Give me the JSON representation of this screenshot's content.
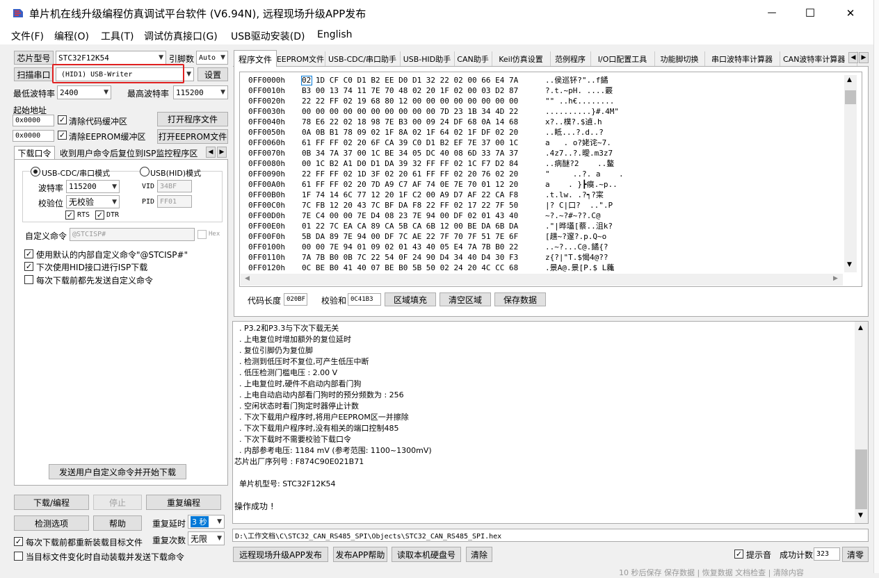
{
  "window": {
    "title": "单片机在线升级编程仿真调试平台软件 (V6.94N), 远程现场升级APP发布",
    "minimize": "—",
    "maximize": "☐",
    "close": "✕"
  },
  "menu": [
    "文件(F)",
    "编程(O)",
    "工具(T)",
    "调试仿真接口(G)",
    "USB驱动安装(D)",
    "English"
  ],
  "left": {
    "chip_model_btn": "芯片型号",
    "chip_model": "STC32F12K54",
    "pin_count_label": "引脚数",
    "pin_count": "Auto",
    "scan_port_btn": "扫描串口",
    "port": "(HID1) USB-Writer",
    "settings_btn": "设置",
    "min_baud_label": "最低波特率",
    "min_baud": "2400",
    "max_baud_label": "最高波特率",
    "max_baud": "115200",
    "start_addr_label": "起始地址",
    "addr1": "0x0000",
    "clear_code_label": "清除代码缓冲区",
    "open_prog_btn": "打开程序文件",
    "addr2": "0x0000",
    "clear_eeprom_label": "清除EEPROM缓冲区",
    "open_eeprom_btn": "打开EEPROM文件",
    "tab_download": "下载口令",
    "tab_reset": "收到用户命令后复位到ISP监控程序区",
    "usb_cdc_mode": "USB-CDC/串口模式",
    "usb_hid_mode": "USB(HID)模式",
    "baud_label": "波特率",
    "baud": "115200",
    "parity_label": "校验位",
    "parity": "无校验",
    "rts": "RTS",
    "dtr": "DTR",
    "vid_label": "VID",
    "vid": "34BF",
    "pid_label": "PID",
    "pid": "FF01",
    "custom_cmd_label": "自定义命令",
    "custom_cmd": "@STCISP#",
    "hex_label": "Hex",
    "opt1": "使用默认的内部自定义命令\"@STCISP#\"",
    "opt2": "下次使用HID接口进行ISP下载",
    "opt3": "每次下载前都先发送自定义命令",
    "send_cmd_btn": "发送用户自定义命令并开始下载",
    "download_btn": "下载/编程",
    "stop_btn": "停止",
    "reprogram_btn": "重复编程",
    "check_btn": "检测选项",
    "help_btn": "帮助",
    "repeat_delay_label": "重复延时",
    "repeat_delay": "3 秒",
    "repeat_count_label": "重复次数",
    "repeat_count": "无限",
    "reload_label": "每次下载前都重新装载目标文件",
    "autoload_label": "当目标文件变化时自动装载并发送下载命令"
  },
  "tabs": [
    "程序文件",
    "EEPROM文件",
    "USB-CDC/串口助手",
    "USB-HID助手",
    "CAN助手",
    "Keil仿真设置",
    "范例程序",
    "I/O口配置工具",
    "功能脚切换",
    "串口波特率计算器",
    "CAN波特率计算器"
  ],
  "hex": {
    "rows": [
      {
        "addr": "0FF0000h",
        "bytes": "02 1D CF C0 D1 B2 EE D0 D1 32 22 02 00 66 E4 7A",
        "ascii": "..侯巡钚?\"..f鐍"
      },
      {
        "addr": "0FF0010h",
        "bytes": "B3 00 13 74 11 7E 70 48 02 20 1F 02 00 03 D2 87",
        "ascii": "?.t.~pH. ....覈"
      },
      {
        "addr": "0FF0020h",
        "bytes": "22 22 FF 02 19 68 80 12 00 00 00 00 00 00 00 00",
        "ascii": "\"\" ..h€........"
      },
      {
        "addr": "0FF0030h",
        "bytes": "00 00 00 00 00 00 00 00 00 00 7D 23 1B 34 4D 22",
        "ascii": "..........}#.4M\""
      },
      {
        "addr": "0FF0040h",
        "bytes": "78 E6 22 02 18 98 7E B3 00 09 24 DF 68 0A 14 68",
        "ascii": "x?..樸?.$遉.h"
      },
      {
        "addr": "0FF0050h",
        "bytes": "0A 0B B1 78 09 02 1F 8A 02 1F 64 02 1F DF 02 20",
        "ascii": "..眡...?.d..?"
      },
      {
        "addr": "0FF0060h",
        "bytes": "61 FF FF 02 20 6F CA 39 C0 D1 B2 EF 7E 37 00 1C",
        "ascii": "a   . o?姥诧~7."
      },
      {
        "addr": "0FF0070h",
        "bytes": "0B 34 7A 37 00 1C BE 34 05 DC 40 08 6D 33 7A 37",
        "ascii": ".4z7..?.曖.m3z7"
      },
      {
        "addr": "0FF0080h",
        "bytes": "00 1C B2 A1 D0 D1 DA 39 32 FF FF 02 1C F7 D2 84",
        "ascii": "..病醚?2    ..鳌"
      },
      {
        "addr": "0FF0090h",
        "bytes": "22 FF FF 02 1D 3F 02 20 61 FF FF 02 20 76 02 20",
        "ascii": "\"     ..?. a    ."
      },
      {
        "addr": "0FF00A0h",
        "bytes": "61 FF FF 02 20 7D A9 C7 AF 74 0E 7E 70 01 12 20",
        "ascii": "a    . }┣瘼.~p.."
      },
      {
        "addr": "0FF00B0h",
        "bytes": "1F 74 14 6C 77 12 20 1F C2 00 A9 D7 AF 22 CA F8",
        "ascii": ".t.lw. .?┑?寀"
      },
      {
        "addr": "0FF00C0h",
        "bytes": "7C FB 12 20 43 7C BF DA F8 22 FF 02 17 22 7F 50",
        "ascii": "|? C|口?  ..\".P"
      },
      {
        "addr": "0FF00D0h",
        "bytes": "7E C4 00 00 7E D4 08 23 7E 94 00 DF 02 01 43 40",
        "ascii": "~?.~?#~??.C@"
      },
      {
        "addr": "0FF00E0h",
        "bytes": "01 22 7C EA CA 89 CA 5B CA 6B 12 00 BE DA 6B DA",
        "ascii": ".\"|晔壒[蔡..沮k?"
      },
      {
        "addr": "0FF00F0h",
        "bytes": "5B DA 89 7E 94 00 DF 7C AE 22 7F 70 7F 51 7E 6F",
        "ascii": "[趪~?邃?.p.Q~o"
      },
      {
        "addr": "0FF0100h",
        "bytes": "00 00 7E 94 01 09 02 01 43 40 05 E4 7A 7B B0 22",
        "ascii": "..~?...C@.鐍{?"
      },
      {
        "addr": "0FF0110h",
        "bytes": "7A 7B B0 0B 7C 22 54 0F 24 90 D4 34 40 D4 30 F3",
        "ascii": "z{?|\"T.$愒4@??"
      },
      {
        "addr": "0FF0120h",
        "bytes": "0C BE B0 41 40 07 BE B0 5B 50 02 24 20 4C CC 68",
        "ascii": ".景A@.景[P.$ L蘒"
      }
    ],
    "code_len_label": "代码长度",
    "code_len": "020BF",
    "checksum_label": "校验和",
    "checksum": "0C41B3",
    "fill_btn": "区域填充",
    "clear_btn": "清空区域",
    "save_btn": "保存数据"
  },
  "log": {
    "lines": [
      "  . P3.2和P3.3与下次下载无关",
      "  . 上电复位时增加额外的复位延时",
      "  . 复位引脚仍为复位脚",
      "  . 检测到低压时不复位,可产生低压中断",
      "  . 低压检测门槛电压 : 2.00 V",
      "  . 上电复位时,硬件不启动内部看门狗",
      "  . 上电自动启动内部看门狗时的预分频数为 : 256",
      "  . 空闲状态时看门狗定时器停止计数",
      "  . 下次下载用户程序时,将用户EEPROM区一并擦除",
      "  . 下次下载用户程序时,没有相关的端口控制485",
      "  . 下次下载时不需要校验下载口令",
      "  . 内部参考电压: 1184 mV (参考范围: 1100~1300mV)",
      "芯片出厂序列号 : F874C90E021B71",
      "",
      "  单片机型号: STC32F12K54",
      "",
      "操作成功 !"
    ]
  },
  "bottom": {
    "file_path": "D:\\工作文档\\C\\STC32_CAN_RS485_SPI\\Objects\\STC32_CAN_RS485_SPI.hex",
    "remote_btn": "远程现场升级APP发布",
    "publish_help_btn": "发布APP帮助",
    "read_disk_btn": "读取本机硬盘号",
    "clear_btn": "清除",
    "sound_label": "提示音",
    "success_label": "成功计数",
    "success_count": "323",
    "reset_count_btn": "清零"
  },
  "behind": {
    "status_hint": "10 秒后保存 保存数据 | 恢复数据    文档检查 | 清除内容"
  },
  "colors": {
    "highlight_box": "#e02020",
    "selection": "#0078d7"
  }
}
